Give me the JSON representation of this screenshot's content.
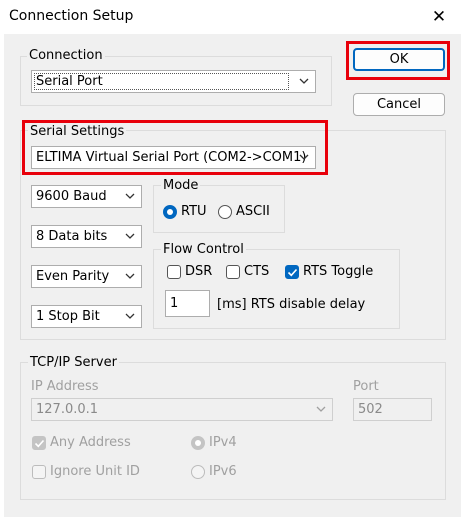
{
  "window": {
    "title": "Connection Setup",
    "close_glyph": "✕"
  },
  "buttons": {
    "ok": "OK",
    "cancel": "Cancel"
  },
  "connection": {
    "label": "Connection",
    "value": "Serial Port"
  },
  "serial_settings": {
    "label": "Serial Settings",
    "port": "ELTIMA Virtual Serial Port (COM2->COM1)",
    "baud": "9600 Baud",
    "data_bits": "8 Data bits",
    "parity": "Even Parity",
    "stop_bits": "1 Stop Bit"
  },
  "mode": {
    "label": "Mode",
    "rtu": "RTU",
    "ascii": "ASCII",
    "selected": "RTU"
  },
  "flow_control": {
    "label": "Flow Control",
    "dsr": "DSR",
    "dsr_checked": false,
    "cts": "CTS",
    "cts_checked": false,
    "rts_toggle": "RTS Toggle",
    "rts_toggle_checked": true,
    "delay_value": "1",
    "delay_label": "[ms] RTS disable delay"
  },
  "tcpip": {
    "label": "TCP/IP Server",
    "ip_label": "IP Address",
    "ip_value": "127.0.0.1",
    "port_label": "Port",
    "port_value": "502",
    "any_address": "Any Address",
    "any_address_checked": true,
    "ignore_unit_id": "Ignore Unit ID",
    "ignore_unit_id_checked": false,
    "ipv4": "IPv4",
    "ipv6": "IPv6",
    "ip_version_selected": "IPv4"
  },
  "colors": {
    "accent": "#0067c0",
    "highlight": "#e8000b",
    "face": "#f0f0f0"
  }
}
